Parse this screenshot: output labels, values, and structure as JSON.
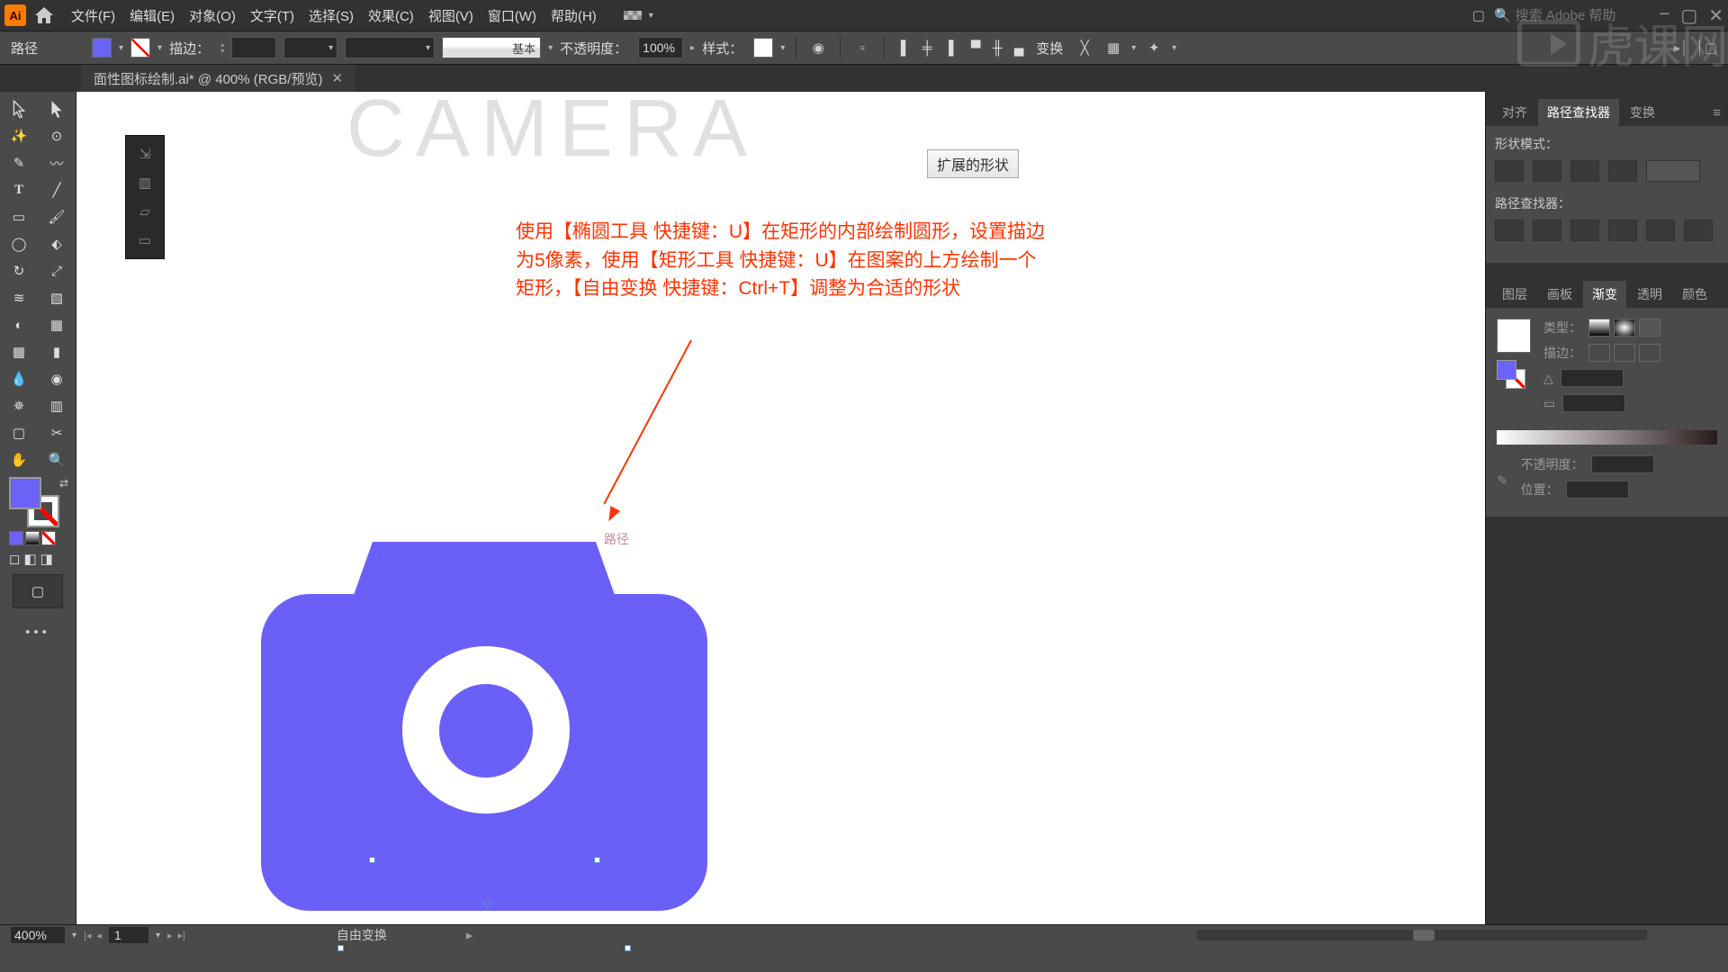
{
  "app": {
    "logo": "Ai"
  },
  "menus": [
    "文件(F)",
    "编辑(E)",
    "对象(O)",
    "文字(T)",
    "选择(S)",
    "效果(C)",
    "视图(V)",
    "窗口(W)",
    "帮助(H)"
  ],
  "search": {
    "placeholder": "搜索 Adobe 帮助"
  },
  "control": {
    "selection_label": "路径",
    "stroke_label": "描边：",
    "style_label": "基本",
    "opacity_label": "不透明度：",
    "opacity_value": "100%",
    "graphic_style_label": "样式：",
    "transform_label": "变换"
  },
  "doc_tab": {
    "title": "面性图标绘制.ai* @ 400% (RGB/预览)"
  },
  "canvas": {
    "header_text": "CAMERA",
    "expand_button": "扩展的形状",
    "annotation_line1": "使用【椭圆工具 快捷键：U】在矩形的内部绘制圆形，设置描边",
    "annotation_line2": "为5像素，使用【矩形工具 快捷键：U】在图案的上方绘制一个",
    "annotation_line3": "矩形，【自由变换 快捷键：Ctrl+T】调整为合适的形状",
    "anchor_label": "路径"
  },
  "panel_align": {
    "tabs": [
      "对齐",
      "路径查找器",
      "变换"
    ],
    "shape_modes_label": "形状模式：",
    "pathfinders_label": "路径查找器："
  },
  "panel_gradient": {
    "tabs": [
      "图层",
      "画板",
      "渐变",
      "透明",
      "颜色"
    ],
    "type_label": "类型：",
    "stroke_label": "描边：",
    "opacity_label": "不透明度：",
    "position_label": "位置："
  },
  "status": {
    "zoom": "400%",
    "artboard": "1",
    "tool": "自由变换"
  },
  "watermark": "虎课网"
}
